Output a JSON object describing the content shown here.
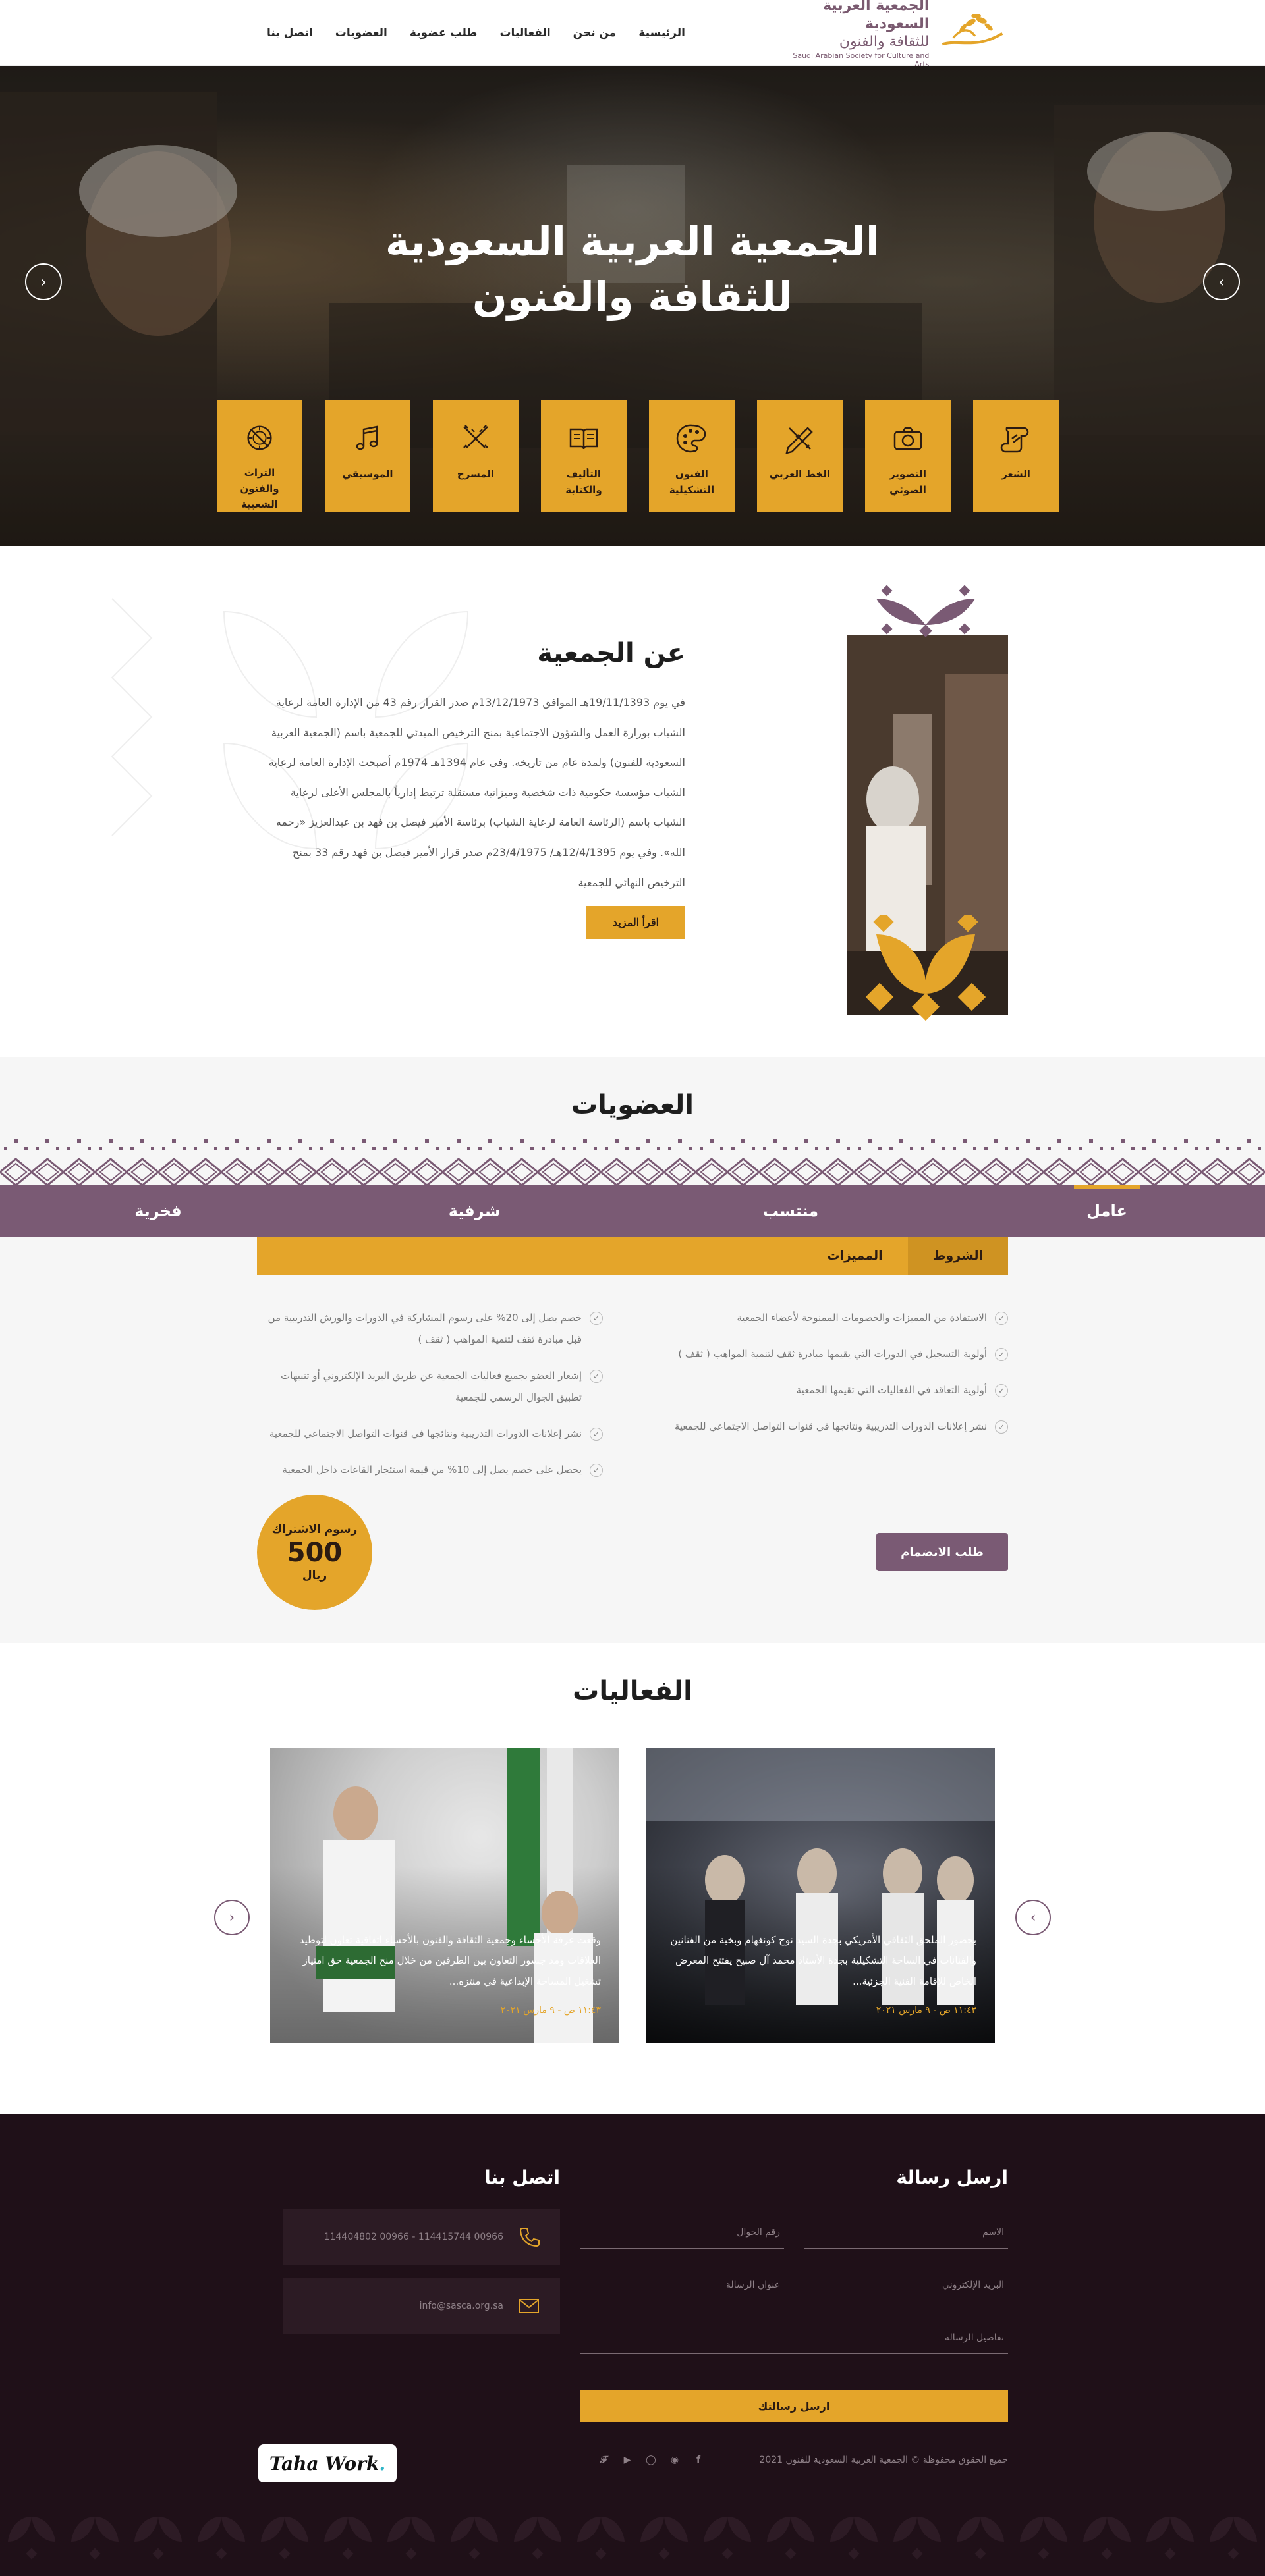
{
  "header": {
    "logo": {
      "line1": "الجمعية العربية السعودية",
      "line2": "للثقافة والفنون",
      "en": "Saudi Arabian Society for Culture and Arts"
    },
    "nav": [
      "الرئيسية",
      "من نحن",
      "الفعاليات",
      "طلب عضوية",
      "العضويات",
      "اتصل بنا"
    ]
  },
  "hero": {
    "title_line1": "الجمعية العربية السعودية",
    "title_line2": "للثقافة والفنون",
    "categories": [
      {
        "label": "الشعر",
        "icon": "scroll-icon"
      },
      {
        "label": "التصوير الضوئي",
        "icon": "camera-icon"
      },
      {
        "label": "الخط العربي",
        "icon": "pen-ruler-icon"
      },
      {
        "label": "الفنون التشكيلية",
        "icon": "palette-icon"
      },
      {
        "label": "التأليف والكتابة",
        "icon": "book-icon"
      },
      {
        "label": "المسرح",
        "icon": "swords-icon"
      },
      {
        "label": "الموسيقي",
        "icon": "music-notes-icon"
      },
      {
        "label": "التراث والفنون الشعبية",
        "icon": "heritage-icon"
      }
    ]
  },
  "about": {
    "title": "عن الجمعية",
    "text": "في يوم 19/11/1393هـ الموافق 13/12/1973م صدر القرار رقم 43 من الإدارة العامة لرعاية الشباب بوزارة العمل والشؤون الاجتماعية بمنح الترخيص المبدئي للجمعية باسم (الجمعية العربية السعودية للفنون) ولمدة عام من تاريخه. وفي عام 1394هـ 1974م أصبحت الإدارة العامة لرعاية الشباب مؤسسة حكومية ذات شخصية وميزانية مستقلة ترتبط إدارياً بالمجلس الأعلى لرعاية الشباب باسم (الرئاسة العامة لرعاية الشباب) برئاسة الأمير فيصل بن فهد بن عبدالعزيز «رحمه الله». وفي يوم 12/4/1395هـ/ 23/4/1975م صدر قرار الأمير فيصل بن فهد رقم 33 بمنح الترخيص النهائي للجمعية",
    "read_more": "اقرأ المزيد"
  },
  "memberships": {
    "title": "العضويات",
    "tabs": [
      "عامل",
      "منتسب",
      "شرفية",
      "فخرية"
    ],
    "active_tab": "عامل",
    "sub_tabs": [
      "الشروط",
      "المميزات"
    ],
    "active_sub_tab": "الشروط",
    "benefits_right": [
      "الاستفادة من المميزات والخصومات الممنوحة لأعضاء الجمعية",
      "أولوية التسجيل في الدورات التي يقيمها مبادرة ثقف لتنمية المواهب ( ثقف )",
      "أولوية التعاقد في الفعاليات التي تقيمها الجمعية",
      "نشر إعلانات الدورات التدريبية ونتائجها في قنوات التواصل الاجتماعي للجمعية"
    ],
    "benefits_left": [
      "خصم يصل إلى 20% على رسوم المشاركة في الدورات والورش التدريبية من قبل مبادرة ثقف لتنمية المواهب ( ثقف )",
      "إشعار العضو بجميع فعاليات الجمعية عن طريق البريد الإلكتروني أو تنبيهات تطبيق الجوال الرسمي للجمعية",
      "نشر إعلانات الدورات التدريبية ونتائجها في قنوات التواصل الاجتماعي للجمعية",
      "يحصل على خصم يصل إلى 10% من قيمة استئجار القاعات داخل الجمعية"
    ],
    "fee": {
      "label": "رسوم الاشتراك",
      "amount": "500",
      "currency": "ريال"
    },
    "join_button": "طلب الانضمام"
  },
  "events": {
    "title": "الفعاليات",
    "cards": [
      {
        "text": "بحضور الملحق الثقافي الأمريكي بجدة السيد نوح كونغهام وبخبة من الفنانين والفنانات في الساحة التشكيلية بجدة الأستاذ محمد آل صبيح يفتتح المعرض الخاص للإقامة الفنية الجزئية...",
        "date": "١١:٤٣ ص - ٩ مارس ٢٠٢١"
      },
      {
        "text": "وقعت غرفة الأحساء وجمعية الثقافة والفنون بالأحساء اتفاقية تعاون لتوطيد العلاقات ومد جسور التعاون بين الطرفين من خلال منح الجمعية حق امتياز تشغيل المساحة الإبداعية في منتزه...",
        "date": "١١:٤٣ ص - ٩ مارس ٢٠٢١"
      }
    ]
  },
  "footer": {
    "send_title": "ارسل رسالة",
    "contact_title": "اتصل بنا",
    "fields": {
      "name": "الاسم",
      "phone": "رقم الجوال",
      "email": "البريد الإلكتروني",
      "subject": "عنوان الرسالة",
      "details": "تفاصيل الرسالة"
    },
    "send_button": "ارسل رسالتك",
    "phones": "00966 114415744 - 00966 114404802",
    "email": "info@sasca.org.sa",
    "copyright": "جميع الحقوق محفوظة © الجمعية العربية السعودية للفنون 2021",
    "socials": [
      "facebook-icon",
      "snapchat-icon",
      "instagram-icon",
      "youtube-icon",
      "twitter-icon"
    ],
    "credit": "Taha Work"
  },
  "colors": {
    "gold": "#e4a52a",
    "plum": "#7a5a74",
    "footer_bg": "#1f1018"
  }
}
